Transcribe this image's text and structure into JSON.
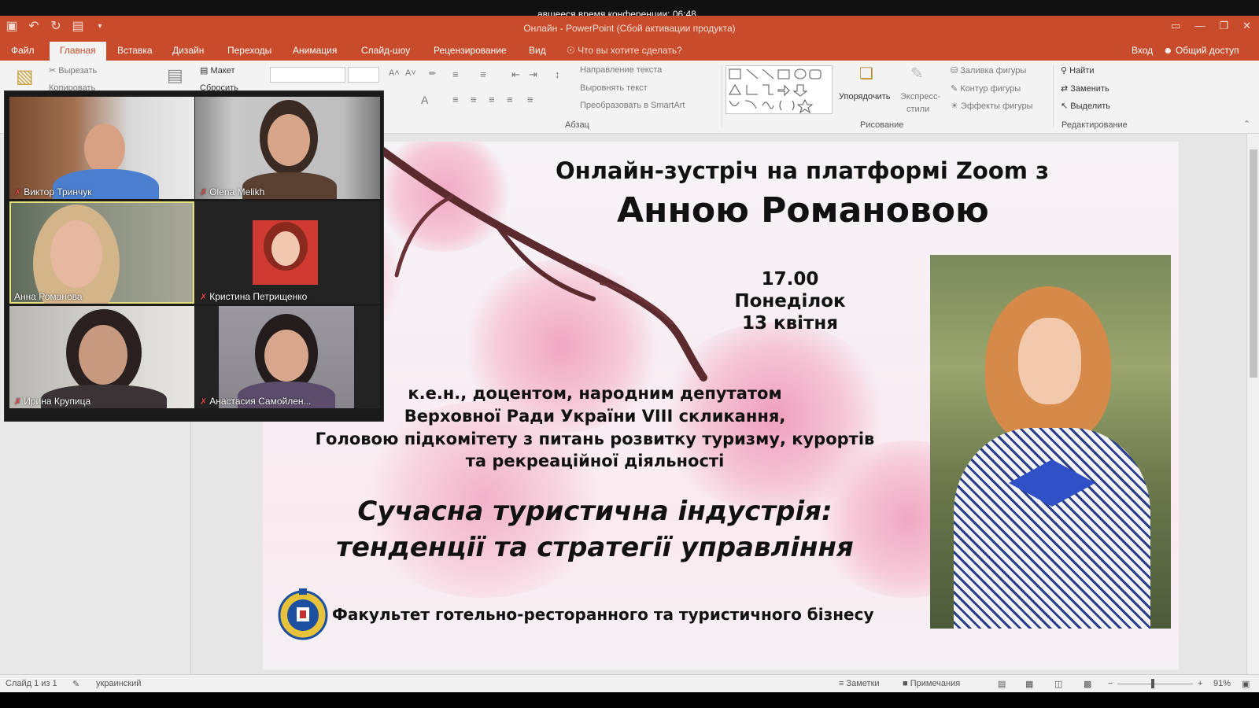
{
  "conference": {
    "timer": "авшееся время конференции: 06:48"
  },
  "window": {
    "title": "Онлайн - PowerPoint (Сбой активации продукта)"
  },
  "ribbon_tabs": [
    "Файл",
    "Главная",
    "Вставка",
    "Дизайн",
    "Переходы",
    "Анимация",
    "Слайд-шоу",
    "Рецензирование",
    "Вид"
  ],
  "active_tab": "Главная",
  "tellme": "Что вы хотите сделать?",
  "account": {
    "signin": "Вход",
    "share": "Общий доступ"
  },
  "ribbon": {
    "clipboard": {
      "cut": "Вырезать",
      "copy": "Копировать"
    },
    "slides": {
      "layout": "Макет",
      "reset": "Сбросить"
    },
    "paragraph": {
      "group": "Абзац",
      "text_direction": "Направление текста",
      "align_text": "Выровнять текст",
      "smartart": "Преобразовать в SmartArt"
    },
    "drawing": {
      "group": "Рисование",
      "arrange": "Упорядочить",
      "quick_styles_1": "Экспресс-",
      "quick_styles_2": "стили",
      "fill": "Заливка фигуры",
      "outline": "Контур фигуры",
      "effects": "Эффекты фигуры"
    },
    "editing": {
      "group": "Редактирование",
      "find": "Найти",
      "replace": "Заменить",
      "select": "Выделить"
    }
  },
  "slide": {
    "line1": "Онлайн-зустріч  на платформі Zoom з",
    "line2": "Анною Романовою",
    "time": "17.00",
    "day": "Понеділок",
    "date": "13 квітня",
    "bio1": "к.е.н.,  доцентом, народним депутатом",
    "bio2": "Верховної Ради України VIII скликання,",
    "bio3": "Головою підкомітету з питань розвитку туризму, курортів",
    "bio4": "та рекреаційної діяльності",
    "topic1": "Сучасна туристична індустрія:",
    "topic2": "тенденції та стратегії управління",
    "faculty": "Факультет готельно-ресторанного та туристичного бізнесу"
  },
  "participants": [
    {
      "name": "Виктор Тринчук",
      "muted": true
    },
    {
      "name": "Olena Melikh",
      "muted": true
    },
    {
      "name": "Анна Романова",
      "muted": false,
      "speaking": true
    },
    {
      "name": "Кристина Петрищенко",
      "muted": true
    },
    {
      "name": "Ирина Крупица",
      "muted": true
    },
    {
      "name": "Анастасия Самойлен...",
      "muted": true
    }
  ],
  "statusbar": {
    "slide": "Слайд 1 из 1",
    "language": "украинский",
    "notes": "Заметки",
    "comments": "Примечания",
    "zoom": "91%"
  },
  "colors": {
    "accent": "#c84b2b",
    "speaker_highlight": "#e6e07a",
    "muted_mic": "#e24b4b"
  }
}
